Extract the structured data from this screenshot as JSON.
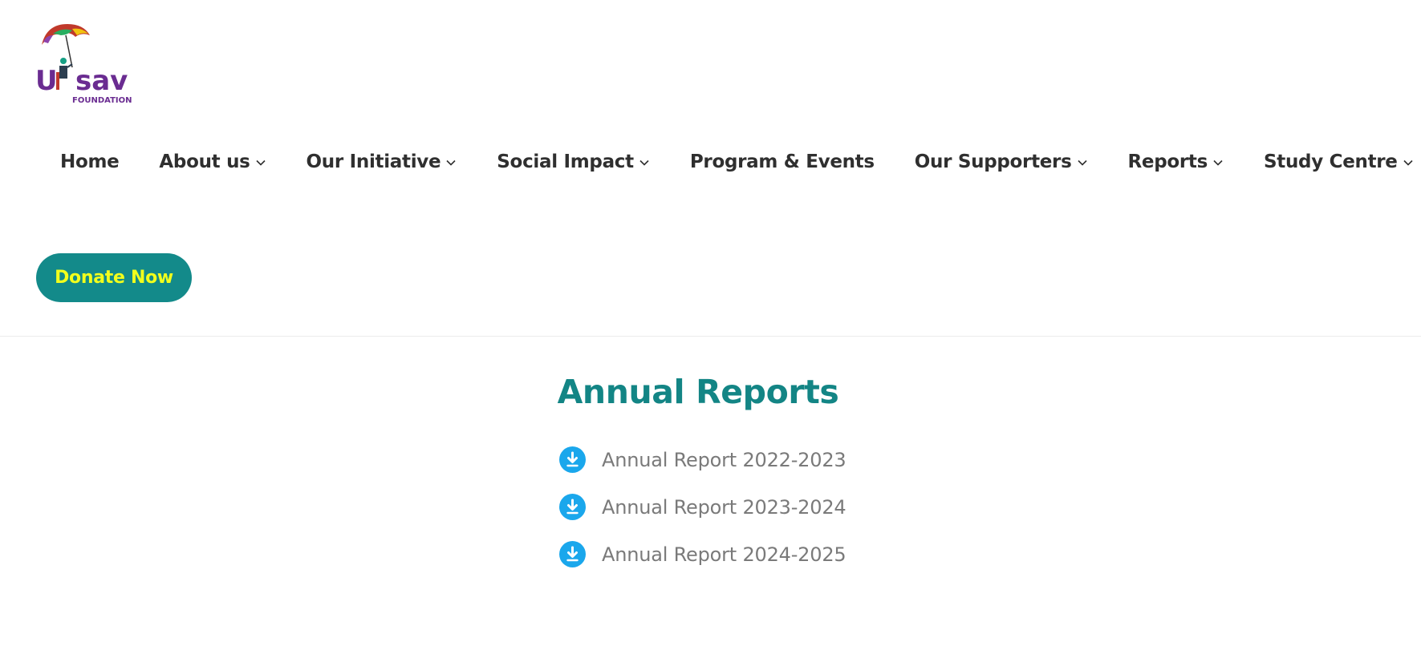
{
  "logo": {
    "brand_text": "Utsav",
    "sub_text": "FOUNDATION"
  },
  "nav": {
    "items": [
      {
        "label": "Home",
        "has_dropdown": false
      },
      {
        "label": "About us",
        "has_dropdown": true
      },
      {
        "label": "Our Initiative",
        "has_dropdown": true
      },
      {
        "label": "Social Impact",
        "has_dropdown": true
      },
      {
        "label": "Program & Events",
        "has_dropdown": false
      },
      {
        "label": "Our Supporters",
        "has_dropdown": true
      },
      {
        "label": "Reports",
        "has_dropdown": true
      },
      {
        "label": "Study Centre",
        "has_dropdown": true
      }
    ]
  },
  "donate": {
    "label": "Donate Now"
  },
  "main": {
    "title": "Annual Reports",
    "reports": [
      {
        "label": "Annual Report 2022-2023",
        "icon": "download-icon"
      },
      {
        "label": "Annual Report 2023-2024",
        "icon": "download-icon"
      },
      {
        "label": "Annual Report 2024-2025",
        "icon": "download-icon"
      }
    ]
  },
  "colors": {
    "accent": "#138a8a",
    "donate_text": "#f2ff1c",
    "download_icon": "#1aa7ec",
    "nav_text": "#2f2f2f",
    "report_text": "#7a7a7a"
  }
}
